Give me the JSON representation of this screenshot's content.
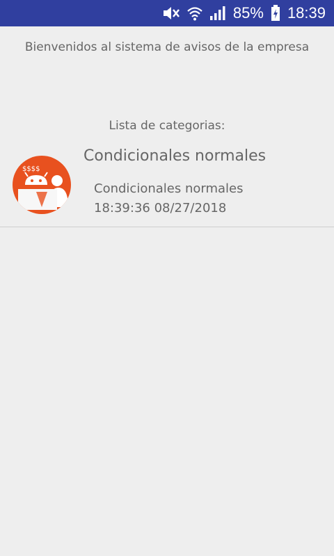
{
  "status_bar": {
    "battery": "85%",
    "time": "18:39",
    "icons": [
      "mute-icon",
      "wifi-icon",
      "signal-icon",
      "battery-charging-icon"
    ],
    "background_color": "#303f9f"
  },
  "main": {
    "welcome_text": "Bienvenidos al sistema de avisos de la empresa",
    "list_title": "Lista de categorias:",
    "category": {
      "name": "Condicionales normales",
      "icon": "android-desk-icon",
      "icon_color": "#e8511f",
      "item_title": "Condicionales normales",
      "item_timestamp": "18:39:36 08/27/2018"
    }
  }
}
